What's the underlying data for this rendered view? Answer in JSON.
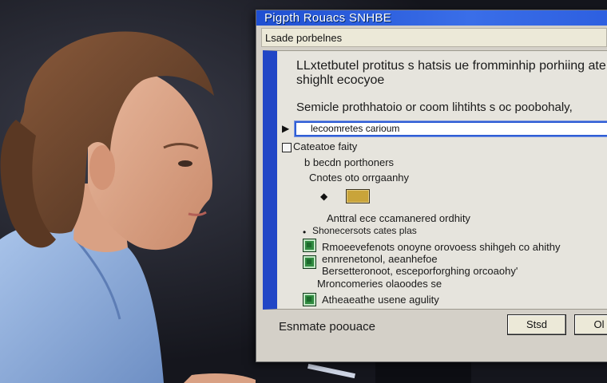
{
  "window": {
    "title": "Pigpth Rouacs SNHBE",
    "menu_label": "Lsade porbelnes"
  },
  "panel": {
    "description": "LLxtetbutel protitus s hatsis ue fromminhip porhiing ate shighlt ecocyoe",
    "subdescription": "Semicle prothhatoio or coom lihtihts s oc poobohaly,",
    "field_value": "lecoomretes carioum",
    "tree": [
      {
        "label": "Cateatoe faity",
        "kind": "checkbox"
      },
      {
        "label": "b becdn porthoners",
        "kind": "text"
      },
      {
        "label": "Cnotes oto orrgaanhy",
        "kind": "text"
      },
      {
        "label": "Anttral ece ccamanered ordhity",
        "kind": "text"
      },
      {
        "label": "Shonecersots cates plas",
        "kind": "text"
      },
      {
        "label": "Rmoeevefenots onoyne orovoess shihgeh co ahithy",
        "kind": "green-icon"
      },
      {
        "label": "ennrenetonol, aeanhefoe",
        "kind": "green-icon"
      },
      {
        "label": "Bersetteronoot, esceporforghing orcoaohy'",
        "kind": "text"
      },
      {
        "label": "Mroncomeries olaoodes se",
        "kind": "text"
      },
      {
        "label": "Atheaeathe usene agulity",
        "kind": "green-icon"
      }
    ],
    "chip_text": "▭"
  },
  "footer": {
    "label": "Esnmate poouace",
    "buttons": [
      {
        "label": "Stsd"
      },
      {
        "label": "Ol"
      }
    ]
  },
  "colors": {
    "title_bar": "#2d5fe0",
    "panel_stripe": "#2146c6",
    "dialog_bg": "#d4d0c8"
  }
}
